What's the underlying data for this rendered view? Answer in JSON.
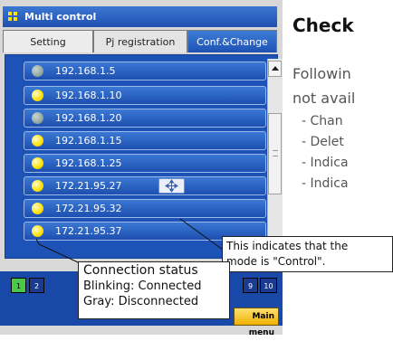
{
  "window": {
    "title": "Multi control"
  },
  "tabs": [
    {
      "label": "Setting"
    },
    {
      "label": "Pj registration"
    },
    {
      "label": "Conf.&Change"
    }
  ],
  "devices": [
    {
      "ip": "192.168.1.5",
      "status_color": "gray"
    },
    {
      "ip": "192.168.1.10",
      "status_color": "yellow"
    },
    {
      "ip": "192.168.1.20",
      "status_color": "gray"
    },
    {
      "ip": "192.168.1.15",
      "status_color": "yellow"
    },
    {
      "ip": "192.168.1.25",
      "status_color": "yellow"
    },
    {
      "ip": "172.21.95.27",
      "status_color": "yellow",
      "control_icon": "move-arrows-icon"
    },
    {
      "ip": "172.21.95.32",
      "status_color": "yellow"
    },
    {
      "ip": "172.21.95.37",
      "status_color": "yellow"
    }
  ],
  "pages": {
    "first": "1",
    "second": "2",
    "ninth": "9",
    "last": "10"
  },
  "main_menu_button": "Main menu",
  "callouts": {
    "control_mode": {
      "line1": "This indicates that the",
      "line2": "mode is \"Control\"."
    },
    "connection_status": {
      "title": "Connection status",
      "line1": "Blinking: Connected",
      "line2": "Gray: Disconnected"
    }
  },
  "doc": {
    "heading": "Check",
    "para_line1": "Followin",
    "para_line2": "not avail",
    "bullets": [
      "- Chan",
      "- Delet",
      "- Indica",
      "- Indica"
    ]
  },
  "colors": {
    "panel_blue": "#1d52b6",
    "dot_yellow": "#ffe100",
    "dot_gray": "#8aa19a",
    "page_active": "#49c84a",
    "menu_button": "#f0b000"
  }
}
